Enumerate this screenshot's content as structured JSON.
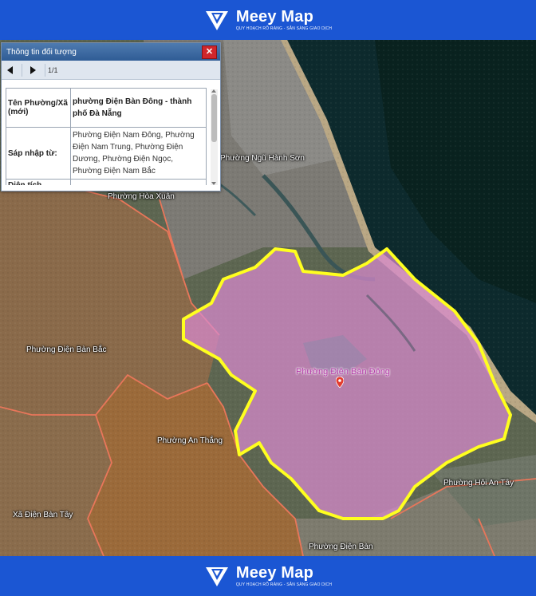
{
  "header": {
    "brand": "Meey Map",
    "tagline": "QUY HOẠCH RÕ RÀNG - SẴN SÀNG GIAO DỊCH"
  },
  "footer": {
    "brand": "Meey Map",
    "tagline": "QUY HOẠCH RÕ RÀNG - SẴN SÀNG GIAO DỊCH"
  },
  "panel": {
    "title": "Thông tin đối tượng",
    "close_icon": "close-icon",
    "page": "1/1",
    "rows": [
      {
        "key": "Tên Phường/Xã (mới)",
        "value": "phường Điện Bàn Đông - thành phố Đà Nẵng"
      },
      {
        "key": "Sáp nhập từ:",
        "value": "Phường Điện Nam Đông, Phường Điện Nam Trung, Phường Điện Dương, Phường Điện Ngọc, Phường Điện Nam Bắc"
      },
      {
        "key": "Diện tích",
        "value": ""
      }
    ]
  },
  "map": {
    "labels": {
      "ngu_hanh_son": "Phường Ngũ Hành Sơn",
      "hoa_xuan": "Phường Hòa Xuân",
      "dien_ban_bac": "Phường Điện Bàn Bắc",
      "dien_ban_dong": "Phường Điện Bàn Đông",
      "an_thang": "Phường An Thắng",
      "hoi_an_tay": "Phường Hội An Tây",
      "dien_ban_tay": "Xã Điện Bàn Tây",
      "dien_ban": "Phường Điện Bàn"
    },
    "colors": {
      "highlight_fill": "#d98bd0",
      "highlight_border": "#ffff1f",
      "boundary": "#e8765a",
      "sea": "#0e2a2e"
    }
  }
}
